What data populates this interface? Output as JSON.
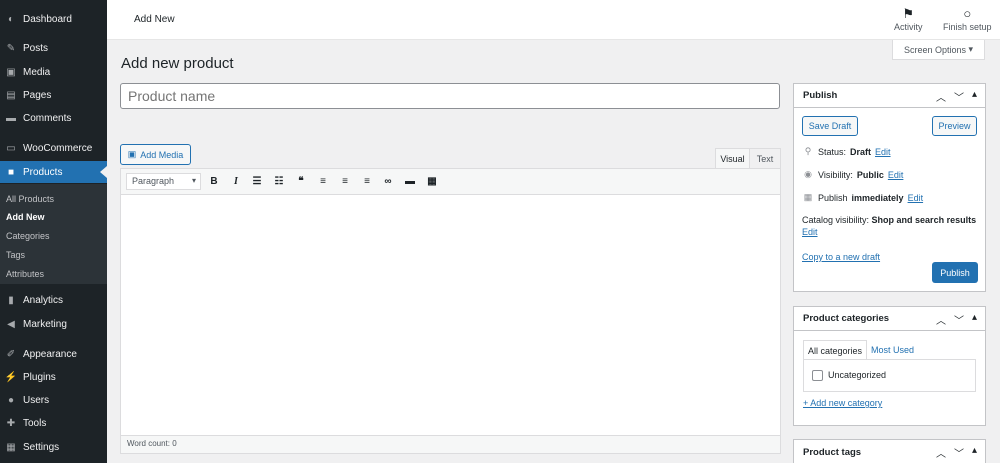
{
  "sidebar": {
    "items": [
      {
        "label": "Dashboard",
        "icon": "dashboard-icon"
      },
      {
        "label": "Posts",
        "icon": "pin-icon"
      },
      {
        "label": "Media",
        "icon": "media-icon"
      },
      {
        "label": "Pages",
        "icon": "pages-icon"
      },
      {
        "label": "Comments",
        "icon": "comment-icon"
      },
      {
        "label": "WooCommerce",
        "icon": "woo-icon"
      },
      {
        "label": "Products",
        "icon": "products-icon"
      },
      {
        "label": "Analytics",
        "icon": "analytics-icon"
      },
      {
        "label": "Marketing",
        "icon": "megaphone-icon"
      },
      {
        "label": "Appearance",
        "icon": "brush-icon"
      },
      {
        "label": "Plugins",
        "icon": "plugin-icon"
      },
      {
        "label": "Users",
        "icon": "users-icon"
      },
      {
        "label": "Tools",
        "icon": "wrench-icon"
      },
      {
        "label": "Settings",
        "icon": "settings-icon"
      }
    ],
    "submenu": [
      "All Products",
      "Add New",
      "Categories",
      "Tags",
      "Attributes"
    ]
  },
  "header": {
    "title": "Add New",
    "activity": "Activity",
    "finish_setup": "Finish setup",
    "screen_options": "Screen Options"
  },
  "page_title": "Add new product",
  "product_name_placeholder": "Product name",
  "editor": {
    "add_media": "Add Media",
    "tab_visual": "Visual",
    "tab_text": "Text",
    "format": "Paragraph",
    "word_count": "Word count: 0"
  },
  "publish": {
    "title": "Publish",
    "save_draft": "Save Draft",
    "preview": "Preview",
    "status_label": "Status:",
    "status_value": "Draft",
    "visibility_label": "Visibility:",
    "visibility_value": "Public",
    "publish_label": "Publish",
    "publish_value": "immediately",
    "catalog_label": "Catalog visibility:",
    "catalog_value": "Shop and search results",
    "edit": "Edit",
    "copy_draft": "Copy to a new draft",
    "publish_button": "Publish"
  },
  "categories": {
    "title": "Product categories",
    "tab_all": "All categories",
    "tab_most": "Most Used",
    "item": "Uncategorized",
    "add_new": "+ Add new category"
  },
  "tags": {
    "title": "Product tags"
  },
  "colors": {
    "sidebar_bg": "#1d2327",
    "accent": "#2271b1"
  }
}
